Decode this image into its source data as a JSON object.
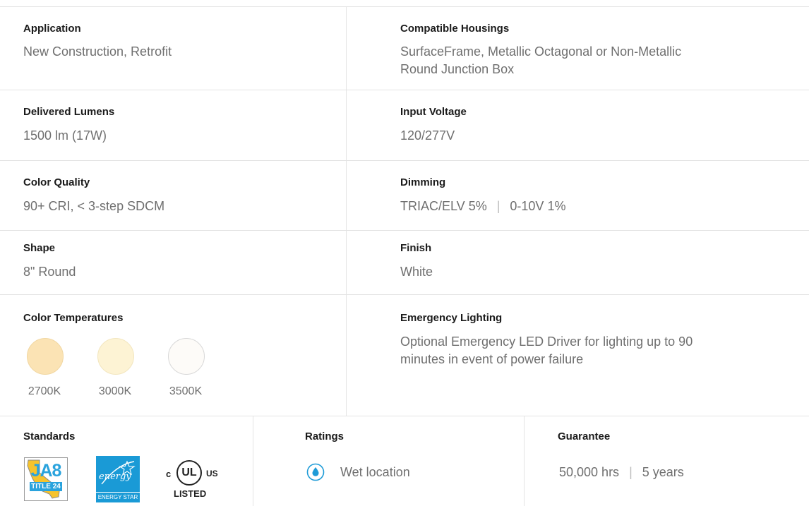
{
  "specs": {
    "application": {
      "label": "Application",
      "value": "New Construction, Retrofit"
    },
    "compatible_housings": {
      "label": "Compatible Housings",
      "line1": "SurfaceFrame, Metallic Octagonal or Non-Metallic",
      "line2": "Round Junction Box"
    },
    "delivered_lumens": {
      "label": "Delivered Lumens",
      "value": "1500 lm (17W)"
    },
    "input_voltage": {
      "label": "Input Voltage",
      "value": "120/277V"
    },
    "color_quality": {
      "label": "Color Quality",
      "value": "90+ CRI, < 3-step SDCM"
    },
    "dimming": {
      "label": "Dimming",
      "option1": "TRIAC/ELV 5%",
      "separator": "|",
      "option2": "0-10V 1%"
    },
    "shape": {
      "label": "Shape",
      "value": "8\" Round"
    },
    "finish": {
      "label": "Finish",
      "value": "White"
    },
    "color_temperatures": {
      "label": "Color Temperatures",
      "items": [
        {
          "label": "2700K",
          "color": "#fbe3b4"
        },
        {
          "label": "3000K",
          "color": "#fdf3d4"
        },
        {
          "label": "3500K",
          "color": "#fdfbf8"
        }
      ]
    },
    "emergency_lighting": {
      "label": "Emergency Lighting",
      "line1": "Optional Emergency LED Driver for lighting up to 90",
      "line2": "minutes in event of power failure"
    }
  },
  "footer": {
    "standards": {
      "label": "Standards",
      "logos": {
        "ja8": {
          "title": "JA8",
          "subtitle": "TITLE 24"
        },
        "energy_star": {
          "script": "energy",
          "text": "ENERGY STAR"
        },
        "ul": {
          "left": "c",
          "mark": "UL",
          "right": "US",
          "bottom": "LISTED"
        }
      }
    },
    "ratings": {
      "label": "Ratings",
      "value": "Wet location",
      "icon": "water-drop-icon"
    },
    "guarantee": {
      "label": "Guarantee",
      "hours": "50,000 hrs",
      "separator": "|",
      "years": "5 years"
    }
  },
  "colors": {
    "divider": "#e3e3e3",
    "energy_star_blue": "#1a9ad6",
    "ja8_blue": "#2aa3dd",
    "ja8_yellow": "#f6c32d",
    "wet_icon_blue": "#1e9bd7"
  }
}
